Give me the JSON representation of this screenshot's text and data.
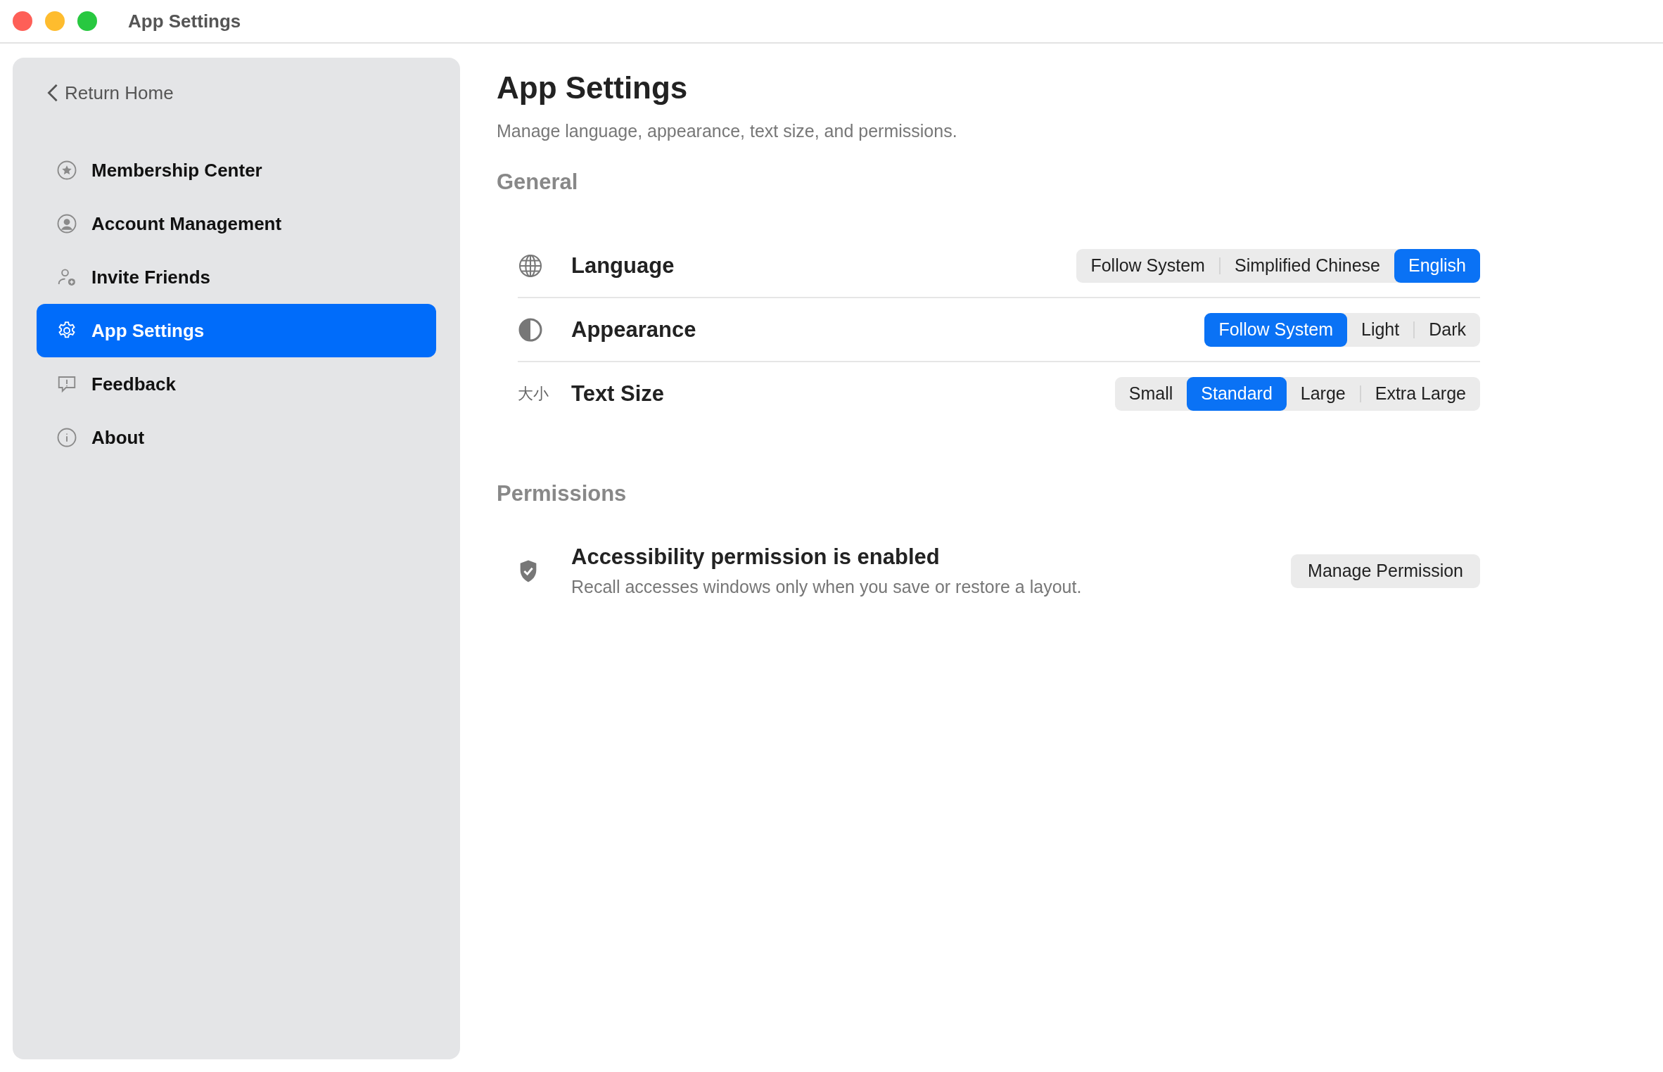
{
  "window": {
    "title": "App Settings"
  },
  "sidebar": {
    "back_link": "Return Home",
    "items": [
      {
        "label": "Membership Center",
        "selected": false
      },
      {
        "label": "Account Management",
        "selected": false
      },
      {
        "label": "Invite Friends",
        "selected": false
      },
      {
        "label": "App Settings",
        "selected": true
      },
      {
        "label": "Feedback",
        "selected": false
      },
      {
        "label": "About",
        "selected": false
      }
    ]
  },
  "page": {
    "title": "App Settings",
    "subtitle": "Manage language, appearance, text size, and permissions."
  },
  "general": {
    "heading": "General",
    "rows": [
      {
        "label": "Language",
        "options": [
          {
            "label": "Follow System",
            "selected": false
          },
          {
            "label": "Simplified Chinese",
            "selected": false
          },
          {
            "label": "English",
            "selected": true
          }
        ]
      },
      {
        "label": "Appearance",
        "options": [
          {
            "label": "Follow System",
            "selected": true
          },
          {
            "label": "Light",
            "selected": false
          },
          {
            "label": "Dark",
            "selected": false
          }
        ]
      },
      {
        "label": "Text Size",
        "icon_text": "大小",
        "options": [
          {
            "label": "Small",
            "selected": false
          },
          {
            "label": "Standard",
            "selected": true
          },
          {
            "label": "Large",
            "selected": false
          },
          {
            "label": "Extra Large",
            "selected": false
          }
        ]
      }
    ]
  },
  "permissions": {
    "heading": "Permissions",
    "title": "Accessibility permission is enabled",
    "description": "Recall accesses windows only when you save or restore a layout.",
    "button": "Manage Permission"
  }
}
